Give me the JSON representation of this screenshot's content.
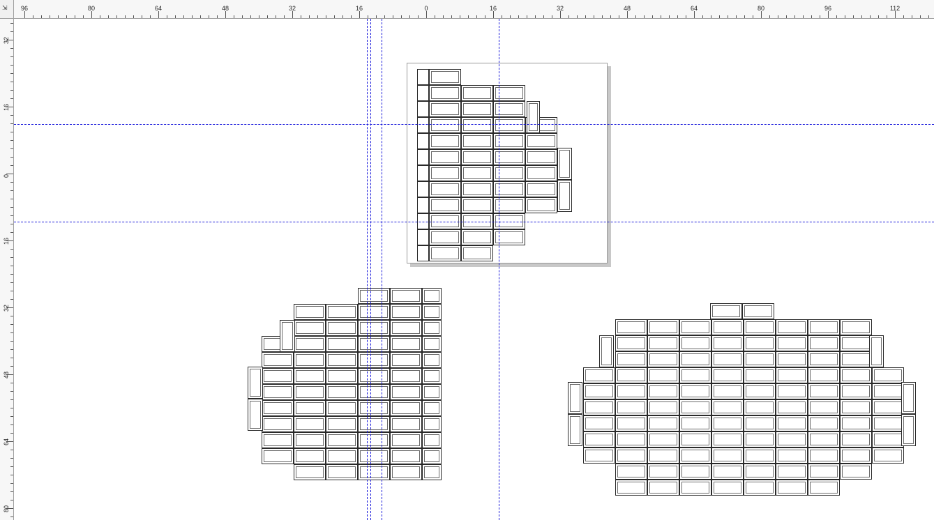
{
  "rulers": {
    "horizontal_labels": [
      "96",
      "80",
      "64",
      "48",
      "32",
      "16",
      "0",
      "16",
      "32",
      "48",
      "64",
      "80",
      "96",
      "112"
    ],
    "vertical_labels": [
      "32",
      "16",
      "0",
      "16",
      "32",
      "48",
      "64",
      "80"
    ]
  },
  "shapes": [
    {
      "name": "brick-pattern-in-page",
      "rows": 12
    },
    {
      "name": "brick-pattern-lower-left",
      "rows": 12
    },
    {
      "name": "brick-pattern-lower-right",
      "rows": 12
    }
  ],
  "colors": {
    "guide": "#1a1adb",
    "outline": "#2a2a2a",
    "ruler_bg": "#f7f7f7",
    "shadow": "#c8c8c8"
  }
}
